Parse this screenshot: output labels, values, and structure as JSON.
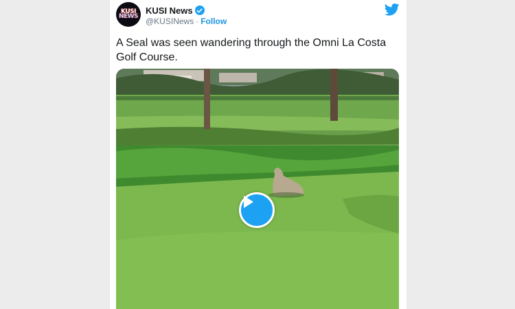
{
  "tweet": {
    "author": {
      "display_name": "KUSI News",
      "handle": "@KUSINews",
      "verified": true,
      "avatar_logo_line1": "KUSI",
      "avatar_logo_line2": "NEWS"
    },
    "separator": "·",
    "follow_label": "Follow",
    "text": "A Seal was seen wandering through the Omni La Costa Golf Course.",
    "media": {
      "type": "video",
      "play_icon": "play-icon"
    }
  },
  "colors": {
    "brand_blue": "#1da1f2",
    "link_blue": "#1b95e0",
    "text": "#14171a",
    "muted": "#657786"
  },
  "icons": {
    "brand": "twitter-bird-icon",
    "verified": "verified-badge-icon"
  }
}
